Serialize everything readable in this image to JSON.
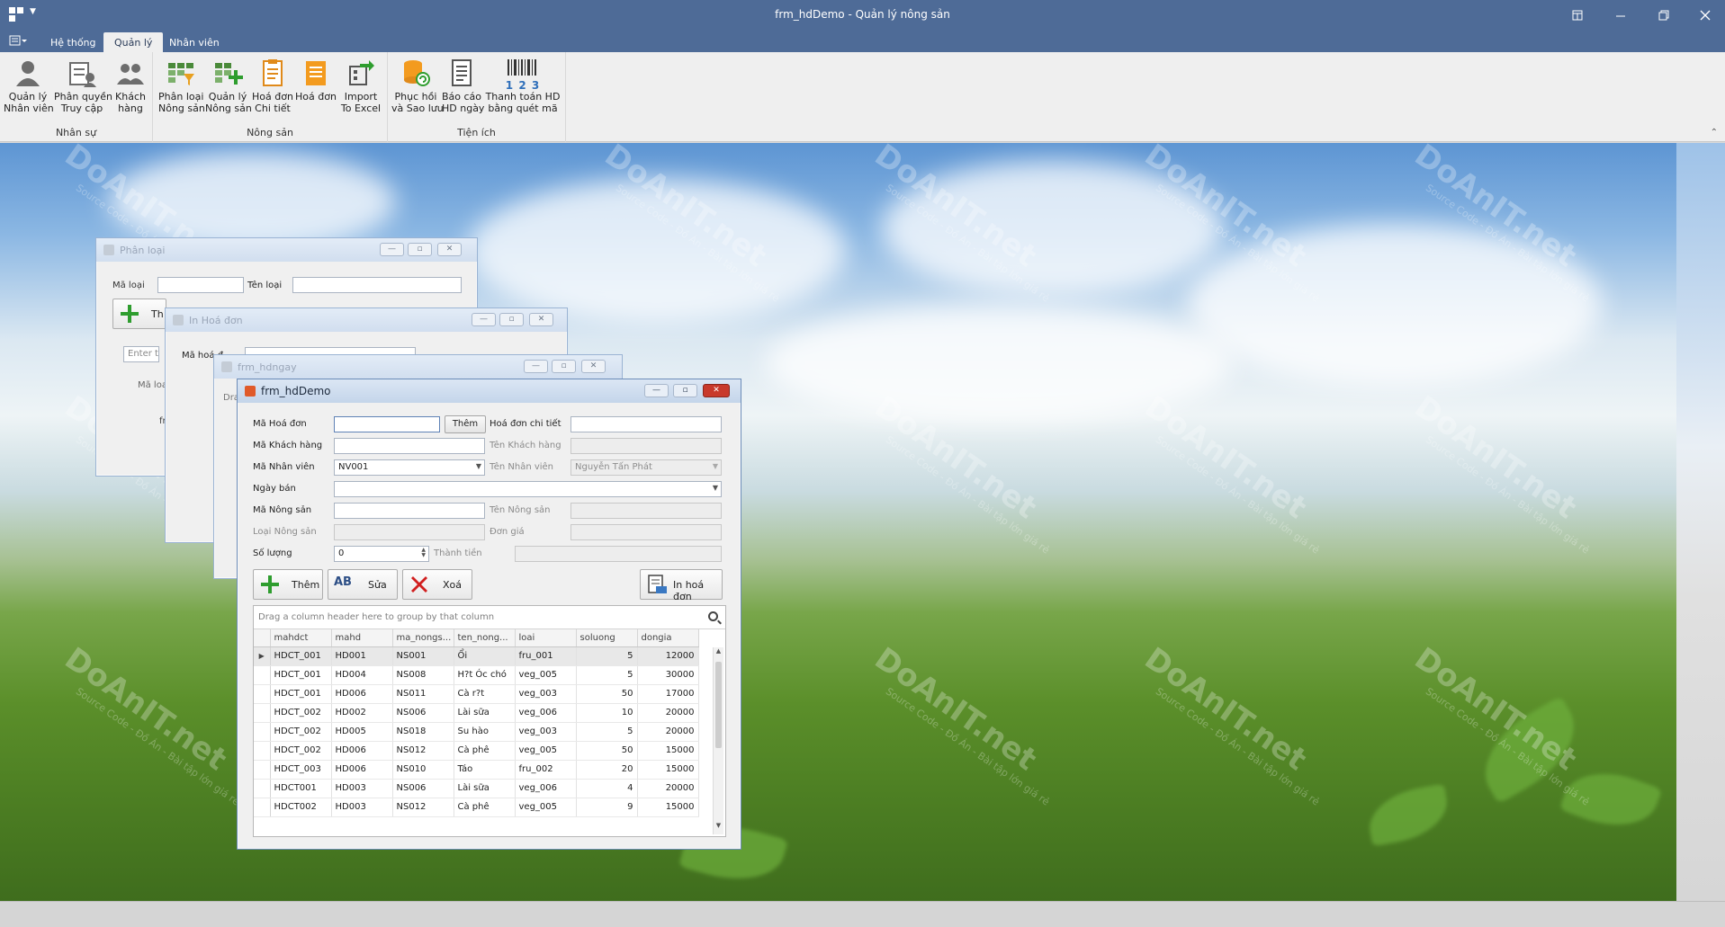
{
  "titlebar": {
    "title": "frm_hdDemo - Quản lý nông sản"
  },
  "tabs": [
    {
      "label": "Hệ thống"
    },
    {
      "label": "Quản lý"
    },
    {
      "label": "Nhân viên"
    }
  ],
  "ribbon": {
    "groups": [
      {
        "caption": "Nhân sự"
      },
      {
        "caption": "Nông sản"
      },
      {
        "caption": "Tiện ích"
      }
    ],
    "buttons": [
      {
        "line1": "Quản lý",
        "line2": "Nhân viên",
        "icon": "user-icon"
      },
      {
        "line1": "Phân quyền",
        "line2": "Truy cập",
        "icon": "permission-icon"
      },
      {
        "line1": "Khách",
        "line2": "hàng",
        "icon": "customers-icon"
      },
      {
        "line1": "Phân loại",
        "line2": "Nông sản",
        "icon": "categorize-icon"
      },
      {
        "line1": "Quản lý",
        "line2": "Nông sản",
        "icon": "manage-products-icon"
      },
      {
        "line1": "Hoá đơn",
        "line2": "Chi tiết",
        "icon": "invoice-detail-icon"
      },
      {
        "line1": "Hoá đơn",
        "line2": "",
        "icon": "invoice-icon"
      },
      {
        "line1": "Import",
        "line2": "To Excel",
        "icon": "import-icon"
      },
      {
        "line1": "Phục hồi",
        "line2": "và Sao lưu",
        "icon": "database-restore-icon"
      },
      {
        "line1": "Báo cáo",
        "line2": "HD ngày",
        "icon": "report-icon"
      },
      {
        "line1": "Thanh toán HD",
        "line2": "bằng quét mã",
        "icon": "barcode-icon"
      }
    ],
    "barcode_digits": "1 2 3"
  },
  "win_phanloai": {
    "title": "Phân loại",
    "ma_loai_label": "Mã loại",
    "ten_loai_label": "Tên loại",
    "add_label": "Th",
    "search_placeholder": "Enter te",
    "col_label": "Mã loa",
    "row_text": "fr"
  },
  "win_inhoadon": {
    "title": "In Hoá đơn",
    "ma_label": "Mã hoá đ"
  },
  "win_hdngay": {
    "title": "frm_hdngay",
    "group_hint": "Drag"
  },
  "form": {
    "title": "frm_hdDemo",
    "fields": {
      "ma_hoa_don_label": "Mã Hoá đơn",
      "ma_hoa_don_value": "",
      "them_small": "Thêm",
      "hd_chi_tiet_label": "Hoá đơn chi tiết",
      "ma_khach_hang_label": "Mã Khách hàng",
      "ten_khach_hang_label": "Tên Khách hàng",
      "ma_nhan_vien_label": "Mã Nhân viên",
      "ma_nhan_vien_value": "NV001",
      "ten_nhan_vien_label": "Tên Nhân viên",
      "ten_nhan_vien_value": "Nguyễn Tấn Phát",
      "ngay_ban_label": "Ngày bán",
      "ma_nong_san_label": "Mã Nông sản",
      "ten_nong_san_label": "Tên Nông sản",
      "loai_nong_san_label": "Loại Nông sản",
      "don_gia_label": "Đơn giá",
      "so_luong_label": "Số lượng",
      "so_luong_value": "0",
      "thanh_tien_label": "Thành tiền"
    },
    "buttons": {
      "them": "Thêm",
      "sua": "Sửa",
      "xoa": "Xoá",
      "in_hoa_don": "In hoá đơn",
      "sua_icon_text": "AB"
    },
    "grid": {
      "group_hint": "Drag a column header here to group by that column",
      "columns": [
        "mahdct",
        "mahd",
        "ma_nongs...",
        "ten_nong...",
        "loai",
        "soluong",
        "dongia"
      ],
      "rows": [
        [
          "HDCT_001",
          "HD001",
          "NS001",
          "Ổi",
          "fru_001",
          "5",
          "12000"
        ],
        [
          "HDCT_001",
          "HD004",
          "NS008",
          "H?t Óc chó",
          "veg_005",
          "5",
          "30000"
        ],
        [
          "HDCT_001",
          "HD006",
          "NS011",
          "Cà r?t",
          "veg_003",
          "50",
          "17000"
        ],
        [
          "HDCT_002",
          "HD002",
          "NS006",
          "Lài sữa",
          "veg_006",
          "10",
          "20000"
        ],
        [
          "HDCT_002",
          "HD005",
          "NS018",
          "Su hào",
          "veg_003",
          "5",
          "20000"
        ],
        [
          "HDCT_002",
          "HD006",
          "NS012",
          "Cà phê",
          "veg_005",
          "50",
          "15000"
        ],
        [
          "HDCT_003",
          "HD006",
          "NS010",
          "Táo",
          "fru_002",
          "20",
          "15000"
        ],
        [
          "HDCT001",
          "HD003",
          "NS006",
          "Lài sữa",
          "veg_006",
          "4",
          "20000"
        ],
        [
          "HDCT002",
          "HD003",
          "NS012",
          "Cà phê",
          "veg_005",
          "9",
          "15000"
        ]
      ]
    }
  },
  "watermark": {
    "brand": "DoAnIT.net",
    "tagline": "Source Code - Đồ Án - Bài tập lớn giá rẻ"
  },
  "colors": {
    "titlebar": "#4e6b97",
    "ribbon": "#efefef",
    "add_green": "#2e9d2e",
    "delete_red": "#d11f1f"
  }
}
